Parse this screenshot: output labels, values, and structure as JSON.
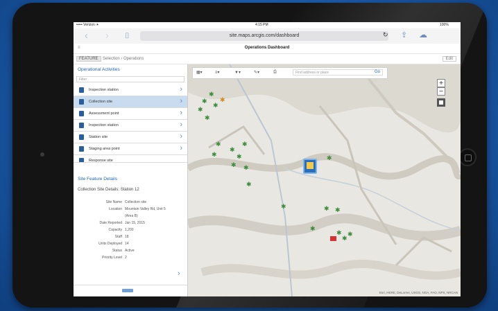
{
  "browser": {
    "status_left": "••••• Verizon  ✈ ",
    "status_time": "4:15 PM",
    "status_right": "100%",
    "url": "site.maps.arcgis.com/dashboard",
    "back_icon": "chevron-left-icon",
    "reload_icon": "reload-icon",
    "share_icon": "share-icon",
    "cloud_icon": "cloud-icon"
  },
  "app": {
    "menu_label": "≡",
    "title": "Operations Dashboard",
    "tag_label": "FEATURE",
    "breadcrumb": "Selection › Operations",
    "right_button": "Edit"
  },
  "sidebar": {
    "heading": "Operational Activities",
    "search_placeholder": "Filter",
    "items": [
      {
        "label": "Inspection station",
        "selected": false
      },
      {
        "label": "Collection site",
        "selected": true
      },
      {
        "label": "Assessment point",
        "selected": false
      },
      {
        "label": "Inspection station",
        "selected": false
      },
      {
        "label": "Station site",
        "selected": false
      },
      {
        "label": "Staging area point",
        "selected": false
      },
      {
        "label": "Response site",
        "selected": false
      }
    ],
    "detail_heading": "Site Feature Details",
    "detail_subheading": "Collection Site Details: Station 12",
    "details": [
      {
        "key": "Site Name",
        "value": "Collection site"
      },
      {
        "key": "Location",
        "value": "Mountain Valley Rd, Unit 5"
      },
      {
        "key": "",
        "value": "(Area B)"
      },
      {
        "key": "Date Reported",
        "value": "Jan 15, 2015"
      },
      {
        "key": "Capacity",
        "value": "1,200"
      },
      {
        "key": "Staff",
        "value": "18"
      },
      {
        "key": "Units Deployed",
        "value": "14"
      },
      {
        "key": "Status",
        "value": "Active"
      },
      {
        "key": "Priority Level",
        "value": "2"
      }
    ]
  },
  "map": {
    "toolbar_find_placeholder": "Find address or place",
    "toolbar_go": "Go",
    "zoom_in": "+",
    "zoom_out": "−",
    "attribution": "Esri, HERE, DeLorme, USGS, NGA, FAO, NPS, NRCAN"
  },
  "colors": {
    "accent": "#2366b7",
    "selected_row": "#c9dcef",
    "marker_green": "#3d8b3d",
    "marker_red": "#d6322f",
    "terrain": "#e9e7e1"
  }
}
